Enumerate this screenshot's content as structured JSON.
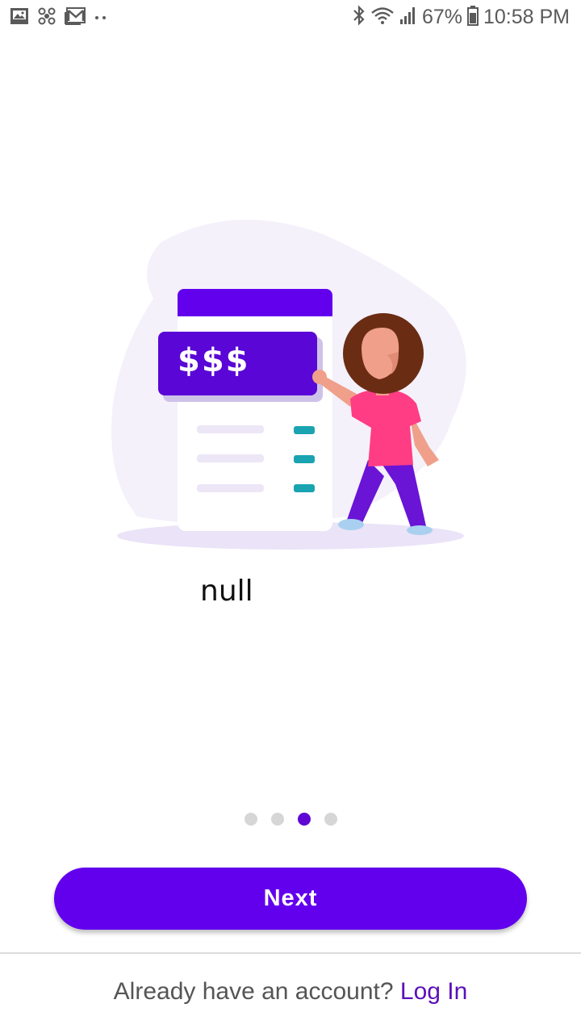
{
  "status_bar": {
    "battery_percent": "67%",
    "time": "10:58 PM",
    "left_icons": [
      "gallery-icon",
      "fan-icon",
      "gmail-icon",
      "more-dots-icon"
    ],
    "right_icons": [
      "bluetooth-icon",
      "wifi-icon",
      "signal-icon",
      "battery-icon"
    ]
  },
  "illustration": {
    "card_amount_text": "$$$",
    "colors": {
      "primary": "#6200ee",
      "accent": "#1aa3b1",
      "shirt": "#ff3d84",
      "blob": "#f4f1fb"
    }
  },
  "slide": {
    "title": "null"
  },
  "pager": {
    "count": 4,
    "active_index": 2
  },
  "actions": {
    "next_label": "Next",
    "login_prompt": "Already have an account?",
    "login_link": "Log In"
  },
  "colors": {
    "primary": "#6200ee",
    "link": "#5b10b8",
    "dot_inactive": "#d6d6d6"
  }
}
